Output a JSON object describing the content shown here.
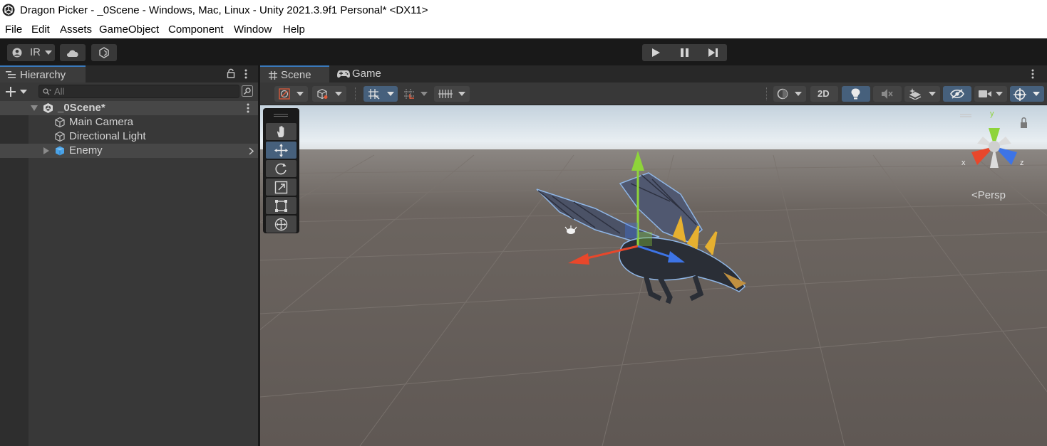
{
  "window": {
    "title": "Dragon Picker - _0Scene - Windows, Mac, Linux - Unity 2021.3.9f1 Personal* <DX11>",
    "icon": "unity-logo-icon"
  },
  "menu": [
    "File",
    "Edit",
    "Assets",
    "GameObject",
    "Component",
    "Window",
    "Help"
  ],
  "toolbar": {
    "account_label": "IR",
    "icons": [
      "account-icon",
      "cloud-icon",
      "collab-icon"
    ],
    "play_controls": [
      "play-icon",
      "pause-icon",
      "step-icon"
    ]
  },
  "hierarchy": {
    "tab_label": "Hierarchy",
    "search_placeholder": "All",
    "scene_name": "_0Scene*",
    "items": [
      {
        "label": "Main Camera",
        "icon": "gameobject-icon"
      },
      {
        "label": "Directional Light",
        "icon": "gameobject-icon"
      },
      {
        "label": "Enemy",
        "icon": "prefab-icon",
        "selected": true
      }
    ]
  },
  "scene_view": {
    "tabs": [
      "Scene",
      "Game"
    ],
    "active_tab": "Scene",
    "toggle_2d": "2D",
    "projection_label": "Persp",
    "gizmo_axes": {
      "x": "x",
      "y": "y",
      "z": "z"
    },
    "tools": [
      "hand-tool",
      "move-tool",
      "rotate-tool",
      "scale-tool",
      "rect-tool",
      "transform-tool"
    ],
    "selected_tool": "move-tool"
  },
  "colors": {
    "accent": "#3a79bb",
    "selection": "#46607c",
    "axis_x": "#e8472b",
    "axis_y": "#8ed43a",
    "axis_z": "#3d74e6"
  }
}
